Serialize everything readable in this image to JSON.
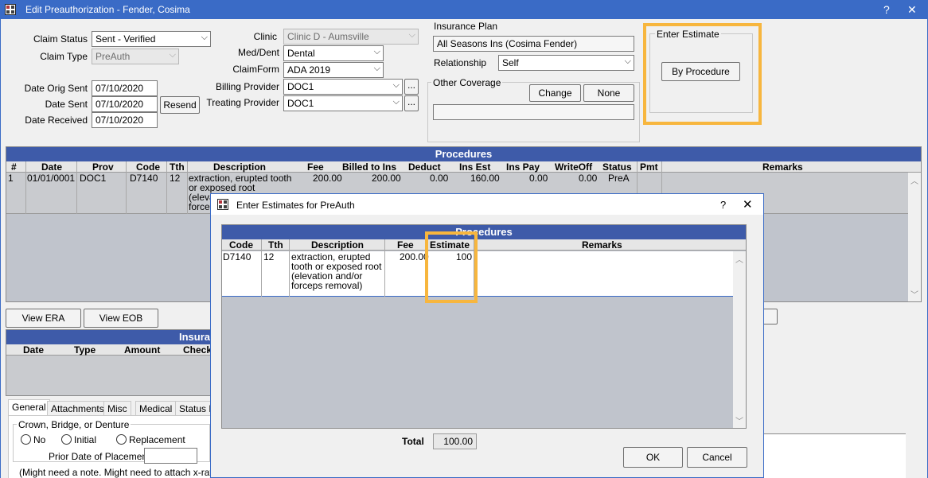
{
  "window": {
    "title": "Edit Preauthorization - Fender, Cosima",
    "help": "?",
    "close": "✕"
  },
  "claim": {
    "status_label": "Claim Status",
    "status_value": "Sent - Verified",
    "type_label": "Claim Type",
    "type_value": "PreAuth",
    "date_orig_sent_label": "Date Orig Sent",
    "date_orig_sent": "07/10/2020",
    "date_sent_label": "Date Sent",
    "date_sent": "07/10/2020",
    "resend": "Resend",
    "date_received_label": "Date Received",
    "date_received": "07/10/2020"
  },
  "clinic": {
    "clinic_label": "Clinic",
    "clinic_value": "Clinic D - Aumsville",
    "meddent_label": "Med/Dent",
    "meddent_value": "Dental",
    "claimform_label": "ClaimForm",
    "claimform_value": "ADA 2019",
    "billing_label": "Billing Provider",
    "billing_value": "DOC1",
    "treating_label": "Treating Provider",
    "treating_value": "DOC1",
    "ellipsis": "..."
  },
  "insurance": {
    "plan_label": "Insurance Plan",
    "plan_value": "All Seasons Ins (Cosima Fender)",
    "relationship_label": "Relationship",
    "relationship_value": "Self",
    "other_label": "Other Coverage",
    "change": "Change",
    "none": "None"
  },
  "estimate": {
    "label": "Enter Estimate",
    "by_procedure": "By Procedure"
  },
  "procedures": {
    "title": "Procedures",
    "columns": [
      "#",
      "Date",
      "Prov",
      "Code",
      "Tth",
      "Description",
      "Fee",
      "Billed to Ins",
      "Deduct",
      "Ins Est",
      "Ins Pay",
      "WriteOff",
      "Status",
      "Pmt",
      "Remarks"
    ],
    "row": {
      "num": "1",
      "date": "01/01/0001",
      "prov": "DOC1",
      "code": "D7140",
      "tth": "12",
      "desc1": "extraction, erupted tooth",
      "desc2": "or exposed root",
      "desc3": "(eleva",
      "desc4": "forcep",
      "fee": "200.00",
      "billed": "200.00",
      "deduct": "0.00",
      "insest": "160.00",
      "inspay": "0.00",
      "writeoff": "0.00",
      "status": "PreA"
    }
  },
  "buttons": {
    "view_era": "View ERA",
    "view_eob": "View EOB"
  },
  "ins_panel": {
    "title": "Insura",
    "columns": [
      "Date",
      "Type",
      "Amount",
      "Check"
    ]
  },
  "tabs": [
    "General",
    "Attachments",
    "Misc",
    "Medical",
    "Status H"
  ],
  "general": {
    "crown_label": "Crown, Bridge, or Denture",
    "no": "No",
    "initial": "Initial",
    "replacement": "Replacement",
    "prior_date": "Prior Date of Placement",
    "note": "(Might need a note. Might need to attach x-ray)"
  },
  "dialog": {
    "title": "Enter Estimates for PreAuth",
    "help": "?",
    "close": "✕",
    "panel_title": "Procedures",
    "columns": [
      "Code",
      "Tth",
      "Description",
      "Fee",
      "Estimate",
      "Remarks"
    ],
    "row": {
      "code": "D7140",
      "tth": "12",
      "desc1": "extraction, erupted",
      "desc2": "tooth or exposed root",
      "desc3": "(elevation and/or",
      "desc4": "forceps removal)",
      "fee": "200.00",
      "estimate": "100"
    },
    "total_label": "Total",
    "total_value": "100.00",
    "ok": "OK",
    "cancel": "Cancel"
  },
  "colors": {
    "titlebar": "#3a6bc6",
    "panel_header": "#3e5ba9",
    "highlight": "#f7b63e"
  }
}
